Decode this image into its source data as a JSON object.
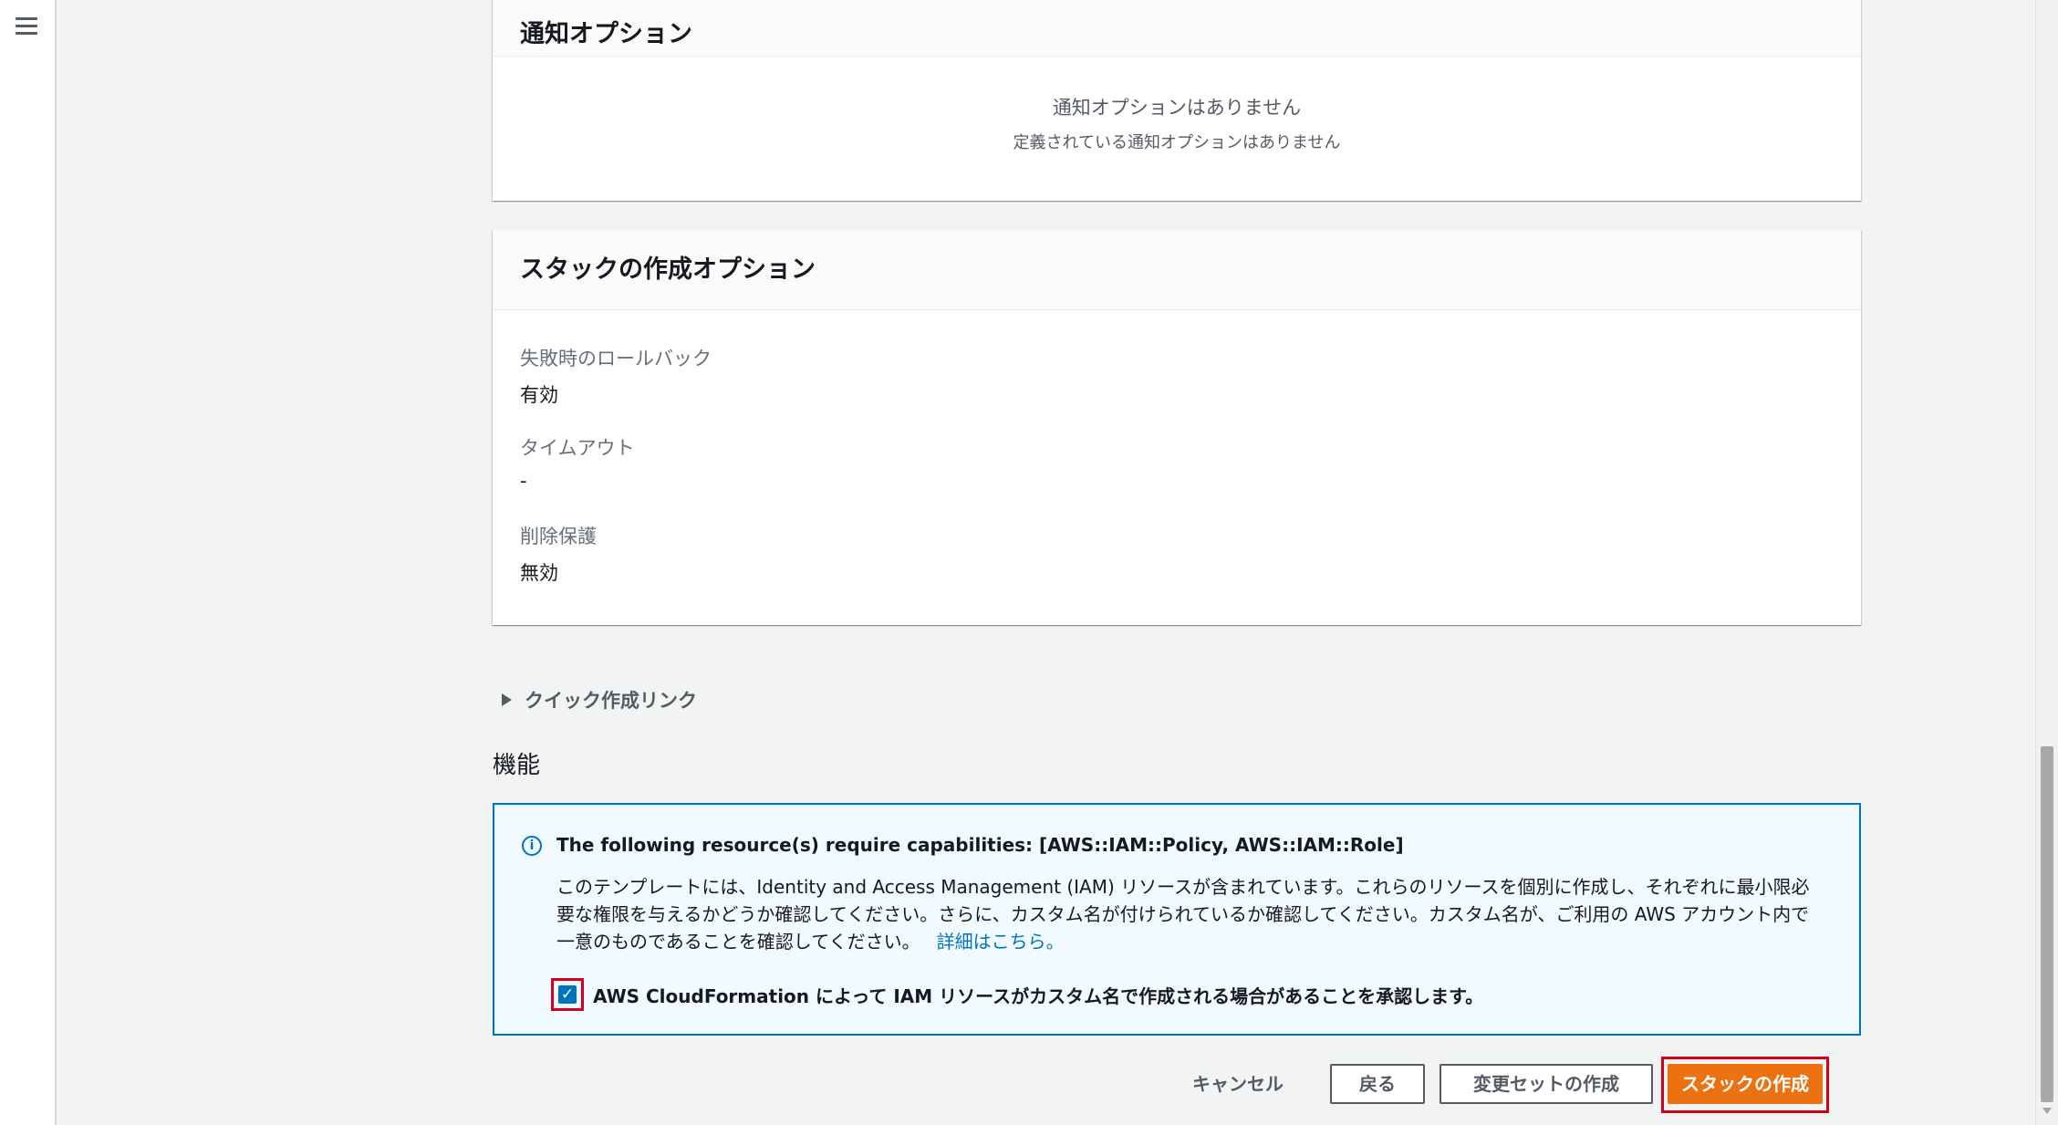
{
  "notifications": {
    "title": "通知オプション",
    "empty_title": "通知オプションはありません",
    "empty_subtitle": "定義されている通知オプションはありません"
  },
  "stack_options": {
    "title": "スタックの作成オプション",
    "items": [
      {
        "label": "失敗時のロールバック",
        "value": "有効"
      },
      {
        "label": "タイムアウト",
        "value": "-"
      },
      {
        "label": "削除保護",
        "value": "無効"
      }
    ]
  },
  "quick_create": {
    "label": "クイック作成リンク"
  },
  "capabilities": {
    "title": "機能",
    "info_title": "The following resource(s) require capabilities: [AWS::IAM::Policy, AWS::IAM::Role]",
    "info_body": "このテンプレートには、Identity and Access Management (IAM) リソースが含まれています。これらのリソースを個別に作成し、それぞれに最小限必要な権限を与えるかどうか確認してください。さらに、カスタム名が付けられているか確認してください。カスタム名が、ご利用の AWS アカウント内で一意のものであることを確認してください。",
    "learn_more": "詳細はこちら。",
    "ack_label": "AWS CloudFormation によって IAM リソースがカスタム名で作成される場合があることを承認します。",
    "ack_checked": true
  },
  "actions": {
    "cancel": "キャンセル",
    "back": "戻る",
    "create_change_set": "変更セットの作成",
    "create_stack": "スタックの作成"
  },
  "colors": {
    "primary": "#ec7211",
    "info_border": "#0073bb",
    "highlight": "#d0021b"
  }
}
